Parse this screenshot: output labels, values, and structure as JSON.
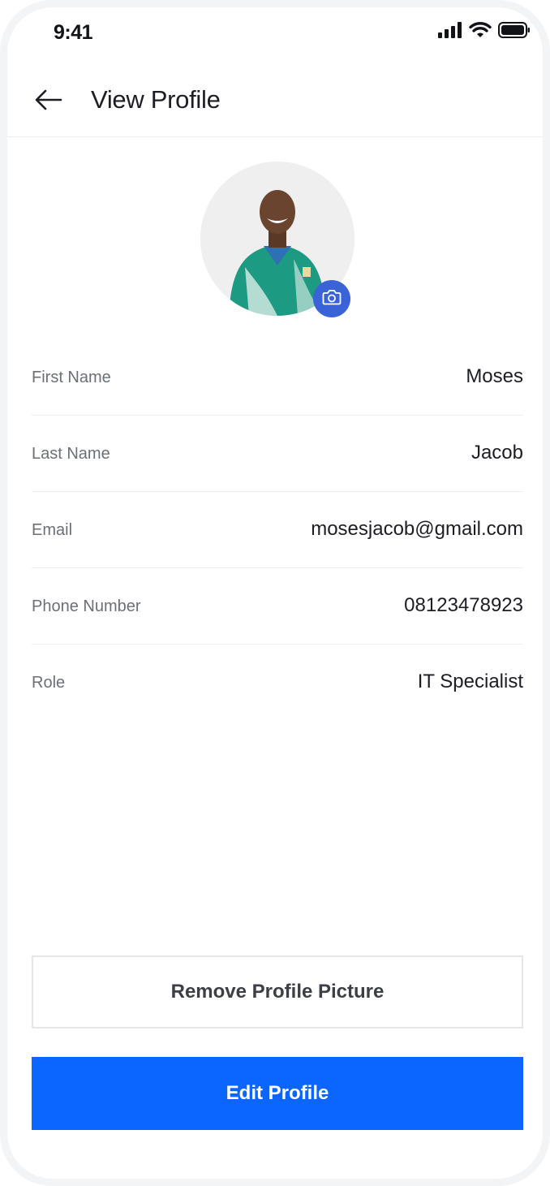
{
  "status_bar": {
    "time": "9:41",
    "icons": [
      "signal-icon",
      "wifi-icon",
      "battery-icon"
    ]
  },
  "header": {
    "title": "View Profile",
    "back_icon": "arrow-left-icon"
  },
  "avatar": {
    "camera_icon": "camera-icon",
    "accent": "#3a63d8"
  },
  "profile": {
    "fields": [
      {
        "label": "First Name",
        "value": "Moses"
      },
      {
        "label": "Last Name",
        "value": "Jacob"
      },
      {
        "label": "Email",
        "value": "mosesjacob@gmail.com"
      },
      {
        "label": "Phone Number",
        "value": "08123478923"
      },
      {
        "label": "Role",
        "value": "IT Specialist"
      }
    ]
  },
  "actions": {
    "remove_picture_label": "Remove Profile Picture",
    "edit_profile_label": "Edit Profile",
    "primary_color": "#0a66ff"
  }
}
